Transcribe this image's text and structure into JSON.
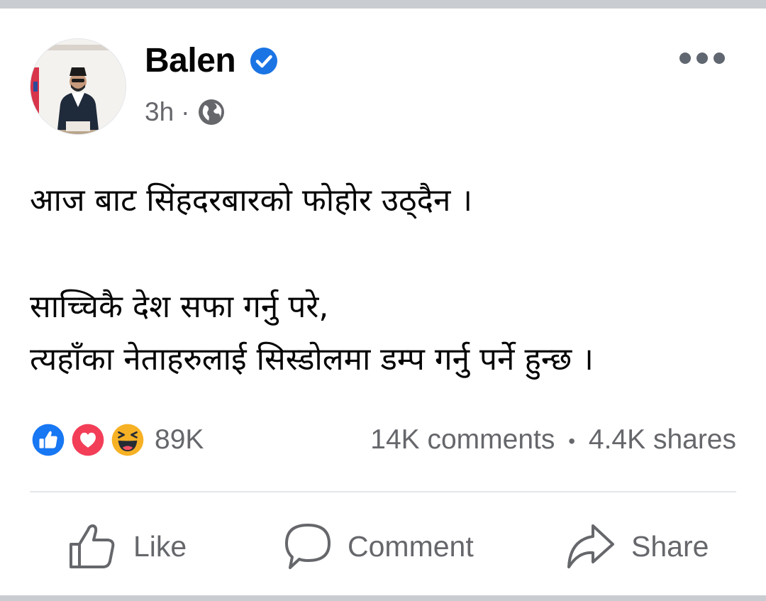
{
  "post": {
    "author": "Balen",
    "verified_icon": "verified-badge-icon",
    "time": "3h",
    "separator": "·",
    "audience_icon": "globe-icon",
    "more_icon": "more-options-icon",
    "body_lines": [
      "आज बाट सिंहदरबारको फोहोर उठ्दैन ।",
      "साच्चिकै देश सफा गर्नु परे,",
      "त्यहाँका नेताहरुलाई सिस्डोलमा डम्प गर्नु पर्ने हुन्छ ।"
    ],
    "reactions": {
      "icons": [
        "like-reaction-icon",
        "love-reaction-icon",
        "haha-reaction-icon"
      ],
      "count": "89K"
    },
    "engagement": {
      "comments": "14K comments",
      "bullet": "•",
      "shares": "4.4K shares"
    }
  },
  "actions": {
    "like": "Like",
    "comment": "Comment",
    "share": "Share"
  },
  "colors": {
    "text": "#050505",
    "muted": "#65676b",
    "verified": "#1b74e4",
    "like": "#1877f2",
    "love": "#f33e58",
    "haha": "#f7b125"
  }
}
